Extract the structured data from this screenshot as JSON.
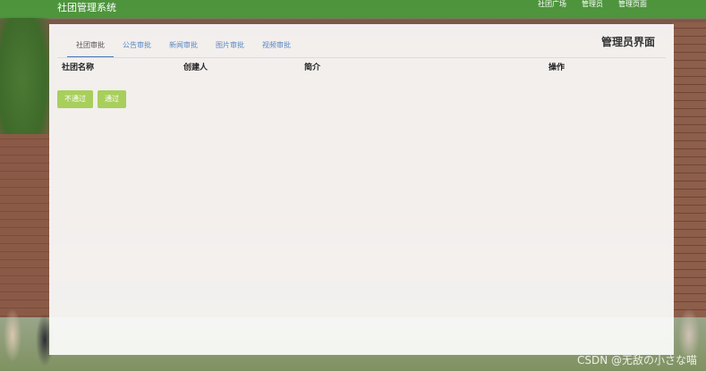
{
  "app": {
    "title": "社团管理系统"
  },
  "topnav": {
    "links": [
      "社团广场",
      "管理员",
      "管理页面"
    ]
  },
  "panel": {
    "title": "管理员界面",
    "tabs": [
      {
        "label": "社团审批",
        "active": true
      },
      {
        "label": "公告审批",
        "active": false
      },
      {
        "label": "新闻审批",
        "active": false
      },
      {
        "label": "图片审批",
        "active": false
      },
      {
        "label": "视频审批",
        "active": false
      }
    ],
    "table": {
      "columns": [
        "社团名称",
        "创建人",
        "简介",
        "操作"
      ]
    },
    "actions": {
      "reject_label": "不通过",
      "approve_label": "通过"
    }
  },
  "watermark": "CSDN @无敌の小さな喵",
  "colors": {
    "topbar": "#4c963c",
    "tab_link": "#5a88c4",
    "button": "#a8cf5b"
  }
}
